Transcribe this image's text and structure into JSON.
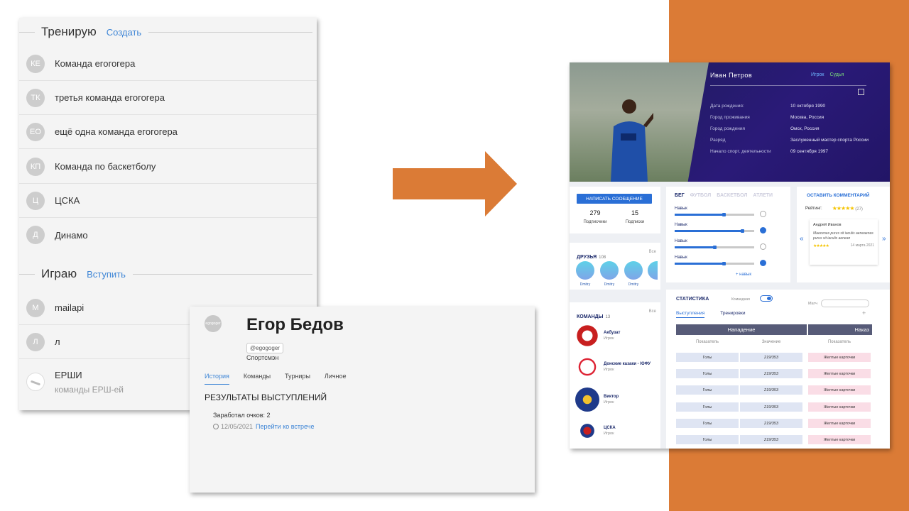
{
  "teams_panel": {
    "training_title": "Тренирую",
    "training_action": "Создать",
    "training_teams": [
      {
        "initials": "КЕ",
        "name": "Команда егогогера"
      },
      {
        "initials": "ТК",
        "name": "третья команда егогогера"
      },
      {
        "initials": "ЕО",
        "name": "ещё одна команда егогогера"
      },
      {
        "initials": "КП",
        "name": "Команда по баскетболу"
      },
      {
        "initials": "Ц",
        "name": "ЦСКА"
      },
      {
        "initials": "Д",
        "name": "Динамо"
      }
    ],
    "playing_title": "Играю",
    "playing_action": "Вступить",
    "playing_teams": [
      {
        "initials": "M",
        "name": "mailapi"
      },
      {
        "initials": "Л",
        "name": "л"
      }
    ],
    "ersh_team": {
      "name": "ЕРШИ",
      "subtitle": "команды ЕРШ-ей"
    }
  },
  "profile_card": {
    "avatar_text": "egogoger",
    "name": "Егор Бедов",
    "handle": "@egogoger",
    "role": "Спортсмэн",
    "tabs": [
      "История",
      "Команды",
      "Турниры",
      "Личное"
    ],
    "active_tab": "История",
    "section_title": "РЕЗУЛЬТАТЫ ВЫСТУПЛЕНИЙ",
    "points_text": "Заработал очков: 2",
    "date": "12/05/2021",
    "meeting_link": "Перейти ко встрече"
  },
  "mockup": {
    "name": "Иван Петров",
    "tag_player": "Игрок",
    "tag_judge": "Судья",
    "info": [
      {
        "key": "Дата рождения:",
        "value": "10 октября 1990"
      },
      {
        "key": "Город проживания",
        "value": "Москва, Россия"
      },
      {
        "key": "Город рождения",
        "value": "Омск, Россия"
      },
      {
        "key": "Разряд",
        "value": "Заслуженный мастер спорта России"
      },
      {
        "key": "Начало спорт. деятельности",
        "value": "09 сентября 1997"
      }
    ],
    "message_button": "НАПИСАТЬ СООБЩЕНИЕ",
    "subscribers_count": "279",
    "subscribers_label": "Подписчики",
    "subscriptions_count": "15",
    "subscriptions_label": "Подписки",
    "friends_title": "ДРУЗЬЯ",
    "friends_count": "108",
    "all_label": "Все",
    "friends": [
      "Dmitry",
      "Dmitry",
      "Dmitry"
    ],
    "teams_title": "КОМАНДЫ",
    "teams_count": "13",
    "teams": [
      {
        "name": "Акбузат",
        "role": "Игрок",
        "color": "#e8e2dc"
      },
      {
        "name": "Донские казаки - ЮФУ",
        "role": "Игрок",
        "color": "#f3d9d2"
      },
      {
        "name": "Виктор",
        "role": "Игрок",
        "color": "#1f3a8a"
      },
      {
        "name": "ЦСКА",
        "role": "Игрок",
        "color": "#f4e7e7"
      }
    ],
    "skill_tabs": [
      "БЕГ",
      "ФУТБОЛ",
      "БАСКЕТБОЛ",
      "АТЛЕТИ"
    ],
    "skills": [
      {
        "label": "Навык",
        "level": 0.62,
        "done": false
      },
      {
        "label": "Навык",
        "level": 0.85,
        "done": true
      },
      {
        "label": "Навык",
        "level": 0.5,
        "done": false
      },
      {
        "label": "Навык",
        "level": 0.62,
        "done": true
      }
    ],
    "add_skill": "+ навык",
    "comment_title": "ОСТАВИТЬ КОММЕНТАРИЙ",
    "rating_label": "Рейтинг:",
    "rating_stars": "★★★★★",
    "rating_count": "(27)",
    "comment_author": "Андрей Иванов",
    "comment_text": "Maecenas purus sit iaculis aeneaenas purus sit iaculis aenean",
    "comment_stars": "★★★★★",
    "comment_date": "14 марта 2021",
    "nav_prev": "«",
    "nav_next": "»",
    "stats_title": "СТАТИСТИКА",
    "stats_toggle_label": "Командная",
    "stats_match_label": "Матч",
    "stats_tab_a": "Выступления",
    "stats_tab_b": "Тренировки",
    "stats_plus": "+",
    "stats_head_attack": "Нападение",
    "stats_head_penalty": "Наказ",
    "stats_col_indicator": "Показатель",
    "stats_col_value": "Значение",
    "stats_col_indicator2": "Показатель",
    "stats_rows": [
      {
        "label": "Голы",
        "value": "219/353",
        "card": "Желтые карточки"
      },
      {
        "label": "Голы",
        "value": "219/353",
        "card": "Желтые карточки"
      },
      {
        "label": "Голы",
        "value": "219/353",
        "card": "Желтые карточки"
      },
      {
        "label": "Голы",
        "value": "219/353",
        "card": "Желтые карточки"
      },
      {
        "label": "Голы",
        "value": "219/353",
        "card": "Желтые карточки"
      },
      {
        "label": "Голы",
        "value": "219/353",
        "card": "Желтые карточки"
      }
    ]
  },
  "colors": {
    "accent_orange": "#db7b36",
    "link_blue": "#3f86d6",
    "header_navy": "#1d1d58"
  }
}
